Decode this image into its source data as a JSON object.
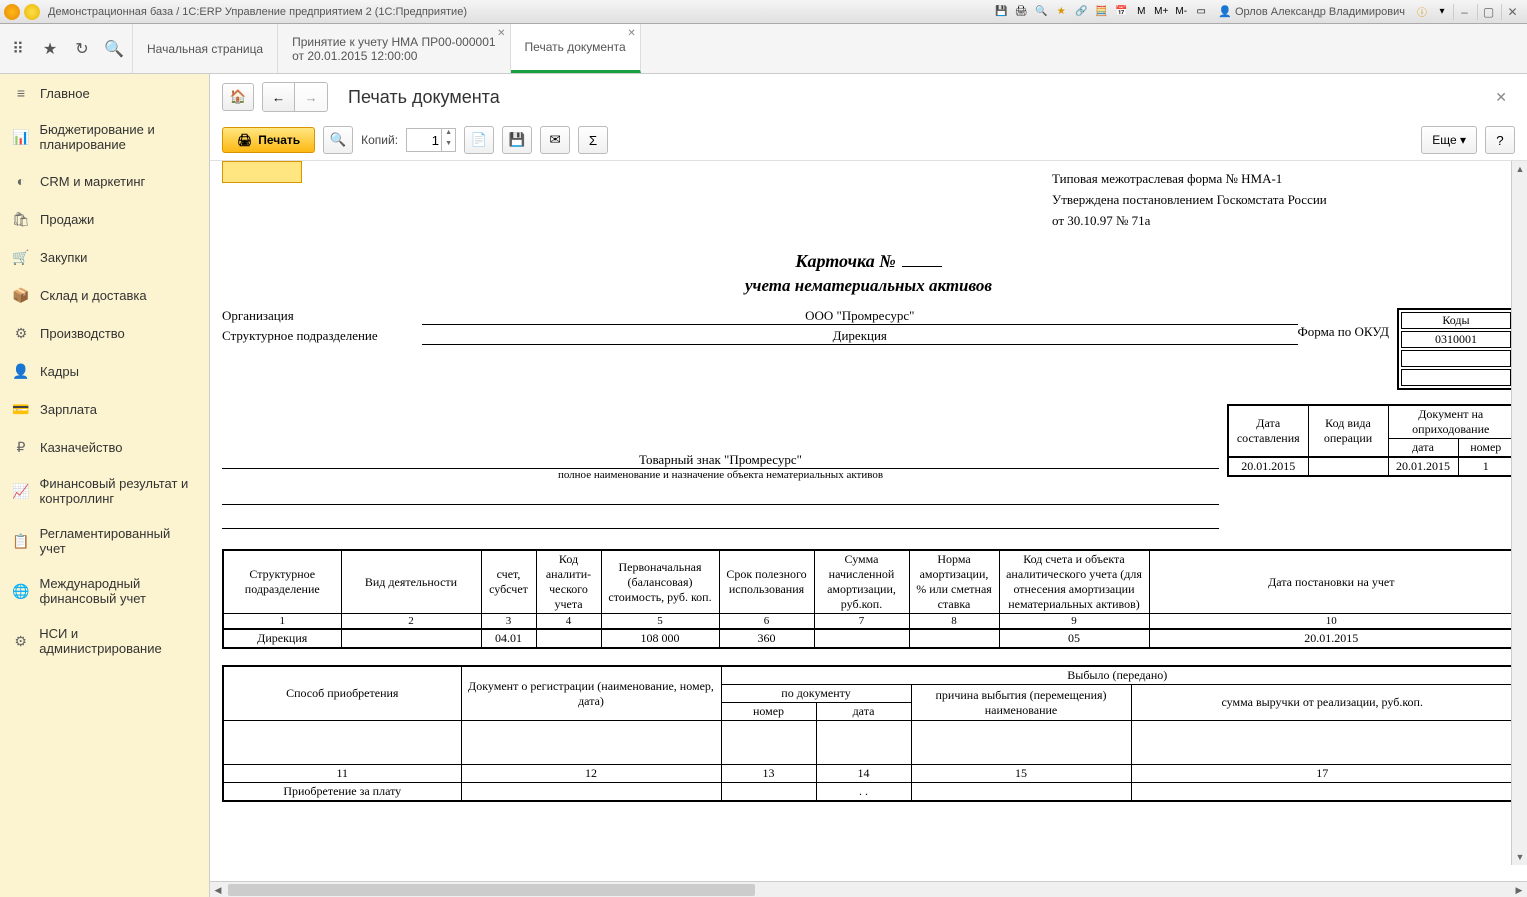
{
  "titlebar": {
    "title": "Демонстрационная база / 1С:ERP Управление предприятием 2  (1С:Предприятие)",
    "user": "Орлов Александр Владимирович",
    "mem_m": "M",
    "mem_mp": "M+",
    "mem_mm": "M-"
  },
  "tabs": {
    "start": "Начальная страница",
    "doc1_line1": "Принятие к учету НМА ПР00-000001",
    "doc1_line2": "от 20.01.2015 12:00:00",
    "print": "Печать документа"
  },
  "sidebar": {
    "items": [
      {
        "icon": "≡",
        "label": "Главное"
      },
      {
        "icon": "📊",
        "label": "Бюджетирование и планирование"
      },
      {
        "icon": "◐",
        "label": "CRM и маркетинг"
      },
      {
        "icon": "🛍",
        "label": "Продажи"
      },
      {
        "icon": "🛒",
        "label": "Закупки"
      },
      {
        "icon": "📦",
        "label": "Склад и доставка"
      },
      {
        "icon": "⚙",
        "label": "Производство"
      },
      {
        "icon": "👤",
        "label": "Кадры"
      },
      {
        "icon": "💳",
        "label": "Зарплата"
      },
      {
        "icon": "₽",
        "label": "Казначейство"
      },
      {
        "icon": "📈",
        "label": "Финансовый результат и контроллинг"
      },
      {
        "icon": "📋",
        "label": "Регламентированный учет"
      },
      {
        "icon": "🌐",
        "label": "Международный финансовый учет"
      },
      {
        "icon": "⚙",
        "label": "НСИ и администрирование"
      }
    ]
  },
  "page": {
    "title": "Печать документа"
  },
  "toolbar": {
    "print": "Печать",
    "copies_label": "Копий:",
    "copies_value": "1",
    "more": "Еще",
    "help": "?"
  },
  "doc": {
    "form_info_1": "Типовая межотраслевая форма № НМА-1",
    "form_info_2": "Утверждена постановлением Госкомстата России",
    "form_info_3": "от 30.10.97 № 71а",
    "title1": "Карточка  №",
    "title2": "учета нематериальных активов",
    "org_label": "Организация",
    "org_value": "ООО \"Промресурс\"",
    "dept_label": "Структурное подразделение",
    "dept_value": "Дирекция",
    "okud_label": "Форма по ОКУД",
    "codes_header": "Коды",
    "okud_code": "0310001",
    "object_name": "Товарный знак \"Промресурс\"",
    "object_caption": "полное наименование и назначение объекта нематериальных активов",
    "ops": {
      "date_comp_h": "Дата составления",
      "op_code_h": "Код вида операции",
      "doc_h": "Документ на оприходование",
      "date_h": "дата",
      "num_h": "номер",
      "date_comp_v": "20.01.2015",
      "op_code_v": "",
      "date_v": "20.01.2015",
      "num_v": "1"
    },
    "t1": {
      "h1": "Структурное подразделение",
      "h2": "Вид деятельности",
      "h3": "счет, субсчет",
      "h4": "Код аналити­чес­кого учета",
      "h5": "Первоначальная (балансовая) стоимость, руб. коп.",
      "h6": "Срок полезного использования",
      "h7": "Сумма начисленной амортизации, руб.коп.",
      "h8": "Норма амортиза­ции, % или сметная ставка",
      "h9": "Код счета и объекта аналитического учета (для отнесения амортизации нематериальных активов)",
      "h10": "Дата постановки на учет",
      "n1": "1",
      "n2": "2",
      "n3": "3",
      "n4": "4",
      "n5": "5",
      "n6": "6",
      "n7": "7",
      "n8": "8",
      "n9": "9",
      "n10": "10",
      "v1": "Дирекция",
      "v2": "",
      "v3": "04.01",
      "v4": "",
      "v5": "108 000",
      "v6": "360",
      "v7": "",
      "v8": "",
      "v9": "05",
      "v10": "20.01.2015"
    },
    "t2": {
      "h1": "Способ приобретения",
      "h2": "Документ о регистрации (наименование, номер, дата)",
      "h3": "Выбыло (передано)",
      "h3a": "по документу",
      "h3b": "причина выбытия (перемещения) наименование",
      "h3c": "сумма выручки от реализации, руб.коп.",
      "h3a1": "номер",
      "h3a2": "дата",
      "n11": "11",
      "n12": "12",
      "n13": "13",
      "n14": "14",
      "n15": "15",
      "n17": "17",
      "v11": "Приобретение за плату",
      "v12": "",
      "v13": "",
      "v14": ". .",
      "v15": "",
      "v17": ""
    }
  }
}
